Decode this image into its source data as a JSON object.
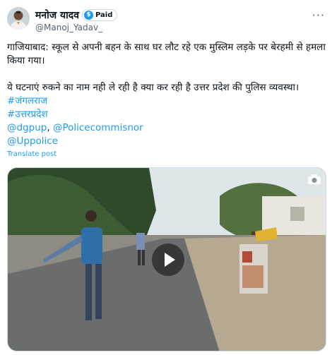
{
  "author": {
    "name": "मनोज यादव",
    "badge": "Paid",
    "badge_icon": "dollar-icon",
    "handle": "@Manoj_Yadav_"
  },
  "post": {
    "line1": "गाजियाबाद: स्कूल से अपनी बहन के साथ घर लौट रहे एक मुस्लिम लड़के पर बेरहमी से हमला किया गया।",
    "line2": "ये घटनाएं रुकने का नाम नही ले रही है क्या कर रही है उत्तर प्रदेश की पुलिस व्यवस्था।",
    "hashtag1": "#जंगलराज",
    "hashtag2": "#उत्तरप्रदेश",
    "mention1": "@dgpup",
    "separator": ", ",
    "mention2": "@Policecommisnor",
    "mention3": "@Uppolice"
  },
  "translate_label": "Translate post",
  "media": {
    "type": "video",
    "play_icon": "play-icon",
    "overlay_icon": "camera-icon"
  },
  "colors": {
    "link": "#1d9bf0",
    "text": "#0f1419",
    "muted": "#536471",
    "border": "#cfd9de"
  }
}
